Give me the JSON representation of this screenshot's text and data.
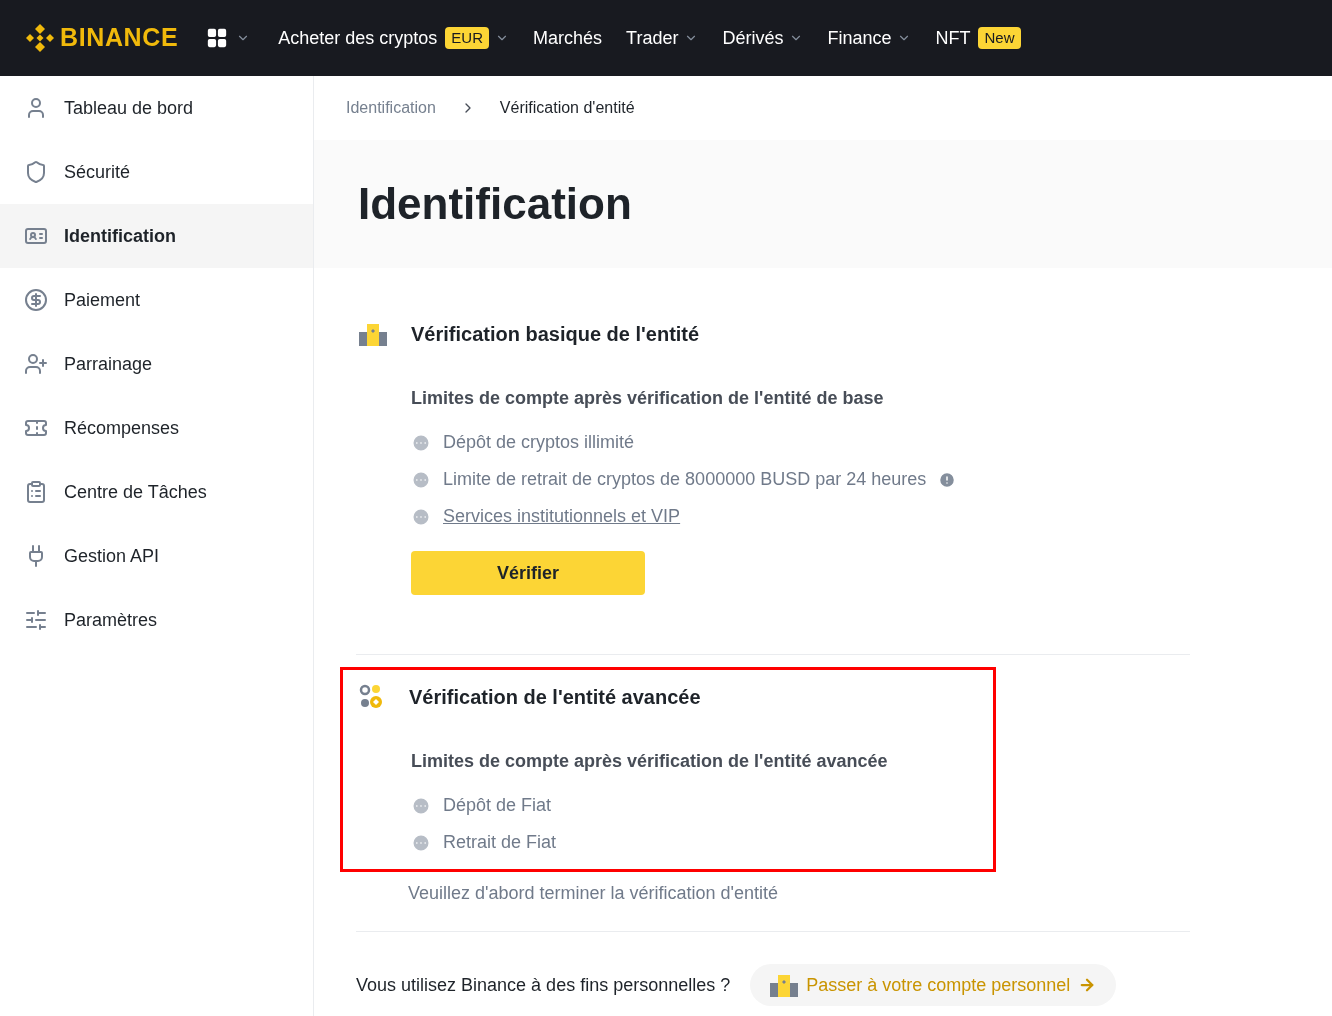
{
  "topbar": {
    "logo": "BINANCE",
    "nav": [
      {
        "label": "Acheter des cryptos",
        "badge": "EUR",
        "dropdown": true
      },
      {
        "label": "Marchés",
        "dropdown": false
      },
      {
        "label": "Trader",
        "dropdown": true
      },
      {
        "label": "Dérivés",
        "dropdown": true
      },
      {
        "label": "Finance",
        "dropdown": true
      },
      {
        "label": "NFT",
        "badge": "New",
        "dropdown": false
      }
    ]
  },
  "sidebar": {
    "items": [
      {
        "label": "Tableau de bord",
        "selected": false
      },
      {
        "label": "Sécurité",
        "selected": false
      },
      {
        "label": "Identification",
        "selected": true
      },
      {
        "label": "Paiement",
        "selected": false
      },
      {
        "label": "Parrainage",
        "selected": false
      },
      {
        "label": "Récompenses",
        "selected": false
      },
      {
        "label": "Centre de Tâches",
        "selected": false
      },
      {
        "label": "Gestion API",
        "selected": false
      },
      {
        "label": "Paramètres",
        "selected": false
      }
    ]
  },
  "breadcrumb": [
    "Identification",
    "Vérification d'entité"
  ],
  "page_title": "Identification",
  "sections": [
    {
      "title": "Vérification basique de l'entité",
      "highlighted": false,
      "subtitle": "Limites de compte après vérification de l'entité de base",
      "items": [
        {
          "kind": "text",
          "text": "Dépôt de cryptos illimité",
          "info": false
        },
        {
          "kind": "text",
          "text": "Limite de retrait de cryptos de 8000000 BUSD par 24 heures",
          "info": true
        },
        {
          "kind": "link",
          "text": "Services institutionnels et VIP",
          "info": false
        }
      ],
      "button": "Vérifier"
    },
    {
      "title": "Vérification de l'entité avancée",
      "highlighted": true,
      "subtitle": "Limites de compte après vérification de l'entité avancée",
      "items": [
        {
          "kind": "text",
          "text": "Dépôt de Fiat",
          "info": false
        },
        {
          "kind": "text",
          "text": "Retrait de Fiat",
          "info": false
        }
      ],
      "note": "Veuillez d'abord terminer la vérification d'entité"
    }
  ],
  "footer": {
    "question": "Vous utilisez Binance à des fins personnelles ?",
    "button": "Passer à votre compte personnel"
  }
}
